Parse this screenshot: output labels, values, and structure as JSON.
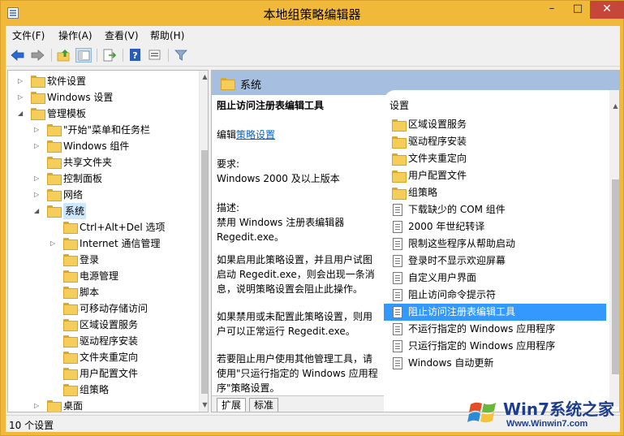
{
  "window": {
    "title": "本地组策略编辑器"
  },
  "menu": [
    "文件(F)",
    "操作(A)",
    "查看(V)",
    "帮助(H)"
  ],
  "tree": [
    {
      "label": "软件设置",
      "indent": 1,
      "exp": "closed"
    },
    {
      "label": "Windows 设置",
      "indent": 1,
      "exp": "closed"
    },
    {
      "label": "管理模板",
      "indent": 1,
      "exp": "open"
    },
    {
      "label": "\"开始\"菜单和任务栏",
      "indent": 2,
      "exp": "closed"
    },
    {
      "label": "Windows 组件",
      "indent": 2,
      "exp": "closed"
    },
    {
      "label": "共享文件夹",
      "indent": 2,
      "exp": "none"
    },
    {
      "label": "控制面板",
      "indent": 2,
      "exp": "closed"
    },
    {
      "label": "网络",
      "indent": 2,
      "exp": "closed"
    },
    {
      "label": "系统",
      "indent": 2,
      "exp": "open",
      "selected": true
    },
    {
      "label": "Ctrl+Alt+Del 选项",
      "indent": 3,
      "exp": "none"
    },
    {
      "label": "Internet 通信管理",
      "indent": 3,
      "exp": "closed"
    },
    {
      "label": "登录",
      "indent": 3,
      "exp": "none"
    },
    {
      "label": "电源管理",
      "indent": 3,
      "exp": "none"
    },
    {
      "label": "脚本",
      "indent": 3,
      "exp": "none"
    },
    {
      "label": "可移动存储访问",
      "indent": 3,
      "exp": "none"
    },
    {
      "label": "区域设置服务",
      "indent": 3,
      "exp": "none"
    },
    {
      "label": "驱动程序安装",
      "indent": 3,
      "exp": "none"
    },
    {
      "label": "文件夹重定向",
      "indent": 3,
      "exp": "none"
    },
    {
      "label": "用户配置文件",
      "indent": 3,
      "exp": "none"
    },
    {
      "label": "组策略",
      "indent": 3,
      "exp": "none"
    },
    {
      "label": "桌面",
      "indent": 2,
      "exp": "closed"
    }
  ],
  "header": {
    "title": "系统"
  },
  "extended": {
    "policy_title": "阻止访问注册表编辑工具",
    "edit_prefix": "编辑",
    "edit_link": "策略设置",
    "req_label": "要求:",
    "req_value": "Windows 2000 及以上版本",
    "desc_label": "描述:",
    "desc_value": "禁用 Windows 注册表编辑器 Regedit.exe。",
    "para1": "如果启用此策略设置，并且用户试图启动 Regedit.exe，则会出现一条消息，说明策略设置会阻止此操作。",
    "para2": "如果禁用或未配置此策略设置，则用户可以正常运行 Regedit.exe。",
    "para3": "若要阻止用户使用其他管理工具，请使用\"只运行指定的 Windows 应用程序\"策略设置。"
  },
  "list": {
    "column": "设置",
    "items": [
      {
        "label": "区域设置服务",
        "type": "folder"
      },
      {
        "label": "驱动程序安装",
        "type": "folder"
      },
      {
        "label": "文件夹重定向",
        "type": "folder"
      },
      {
        "label": "用户配置文件",
        "type": "folder"
      },
      {
        "label": "组策略",
        "type": "folder"
      },
      {
        "label": "下载缺少的 COM 组件",
        "type": "setting"
      },
      {
        "label": "2000 年世纪转译",
        "type": "setting"
      },
      {
        "label": "限制这些程序从帮助启动",
        "type": "setting"
      },
      {
        "label": "登录时不显示欢迎屏幕",
        "type": "setting"
      },
      {
        "label": "自定义用户界面",
        "type": "setting"
      },
      {
        "label": "阻止访问命令提示符",
        "type": "setting"
      },
      {
        "label": "阻止访问注册表编辑工具",
        "type": "setting",
        "selected": true
      },
      {
        "label": "不运行指定的 Windows 应用程序",
        "type": "setting"
      },
      {
        "label": "只运行指定的 Windows 应用程序",
        "type": "setting"
      },
      {
        "label": "Windows 自动更新",
        "type": "setting"
      }
    ]
  },
  "tabs": [
    "扩展",
    "标准"
  ],
  "status": {
    "text": "10 个设置"
  },
  "watermark": {
    "title": "Win7系统之家",
    "url": "Www.Winwin7.com"
  },
  "colors": {
    "title_bar": "#f0b93a",
    "header": "#a6bfe0",
    "selection": "#3399ff",
    "link": "#0066cc"
  }
}
